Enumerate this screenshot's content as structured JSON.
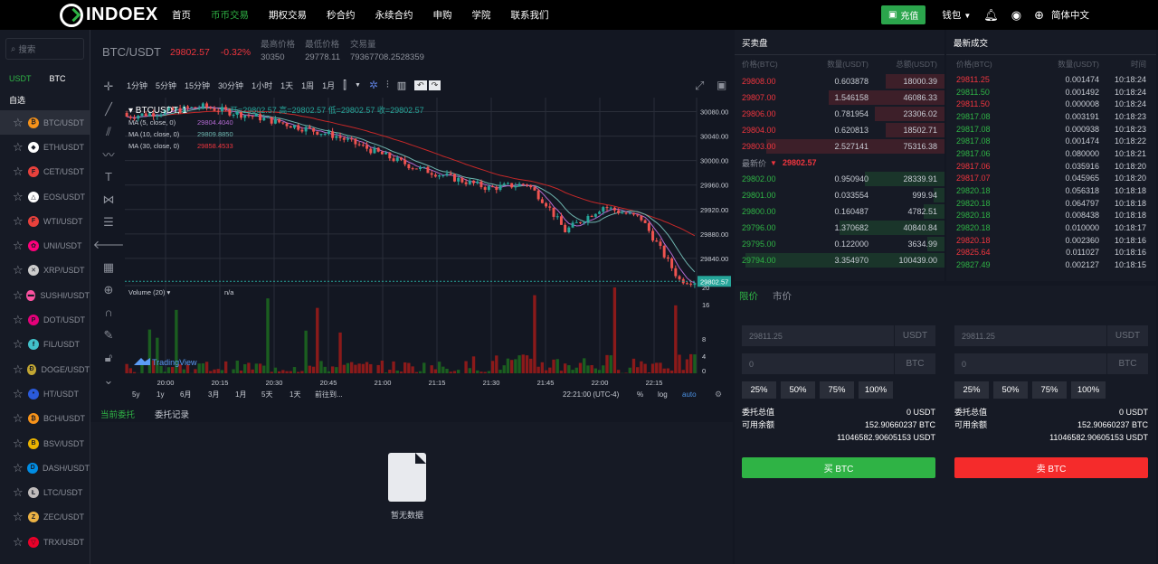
{
  "header": {
    "logo": "INDOEX",
    "nav": [
      "首页",
      "币币交易",
      "期权交易",
      "秒合约",
      "永续合约",
      "申购",
      "学院",
      "联系我们"
    ],
    "recharge": "充值",
    "wallet": "钱包",
    "language": "简体中文"
  },
  "sidebar": {
    "search_placeholder": "搜索",
    "markets": [
      "USDT",
      "BTC"
    ],
    "favorites": "自选",
    "coins": [
      {
        "name": "BTC/USDT",
        "color": "#f7931a",
        "glyph": "₿"
      },
      {
        "name": "ETH/USDT",
        "color": "#ffffff",
        "glyph": "◆"
      },
      {
        "name": "CET/USDT",
        "color": "#e8413c",
        "glyph": "F"
      },
      {
        "name": "EOS/USDT",
        "color": "#ffffff",
        "glyph": "△"
      },
      {
        "name": "WTI/USDT",
        "color": "#e8413c",
        "glyph": "F"
      },
      {
        "name": "UNI/USDT",
        "color": "#ff007a",
        "glyph": "✿"
      },
      {
        "name": "XRP/USDT",
        "color": "#cccccc",
        "glyph": "✕"
      },
      {
        "name": "SUSHI/USDT",
        "color": "#fa52a0",
        "glyph": "▬"
      },
      {
        "name": "DOT/USDT",
        "color": "#e6007a",
        "glyph": "P"
      },
      {
        "name": "FIL/USDT",
        "color": "#42c1ca",
        "glyph": "f"
      },
      {
        "name": "DOGE/USDT",
        "color": "#c2a633",
        "glyph": "Ð"
      },
      {
        "name": "HT/USDT",
        "color": "#2a5ada",
        "glyph": "•"
      },
      {
        "name": "BCH/USDT",
        "color": "#f7931a",
        "glyph": "₿"
      },
      {
        "name": "BSV/USDT",
        "color": "#eab300",
        "glyph": "B"
      },
      {
        "name": "DASH/USDT",
        "color": "#008de4",
        "glyph": "D"
      },
      {
        "name": "LTC/USDT",
        "color": "#bfbbbb",
        "glyph": "Ł"
      },
      {
        "name": "ZEC/USDT",
        "color": "#ecb244",
        "glyph": "Z"
      },
      {
        "name": "TRX/USDT",
        "color": "#eb0029",
        "glyph": "▽"
      }
    ]
  },
  "pair": {
    "name": "BTC/USDT",
    "price": "29802.57",
    "change": "-0.32%",
    "high_label": "最高价格",
    "high": "30350",
    "low_label": "最低价格",
    "low": "29778.11",
    "vol_label": "交易量",
    "vol": "79367708.2528359"
  },
  "chart": {
    "intervals": [
      "1分钟",
      "5分钟",
      "15分钟",
      "30分钟",
      "1小时",
      "1天",
      "1周",
      "1月"
    ],
    "symbol": "BTCUSDT, 1",
    "ohlc": "开=29802.57  高=29802.57  低=29802.57  收=29802.57",
    "ma5": "MA (5, close, 0)",
    "ma5v": "29804.4040",
    "ma10": "MA (10, close, 0)",
    "ma10v": "29809.8850",
    "ma30": "MA (30, close, 0)",
    "ma30v": "29858.4533",
    "volume_label": "Volume (20)",
    "volume_val": "n/a",
    "price_ticks": [
      "30080.00",
      "30040.00",
      "30000.00",
      "29960.00",
      "29920.00",
      "29880.00",
      "29840.00"
    ],
    "last_price_tag": "29802.57",
    "vol_ticks": [
      "20",
      "16",
      "8",
      "4",
      "0"
    ],
    "time_ticks": [
      "20:00",
      "20:15",
      "20:30",
      "20:45",
      "21:00",
      "21:15",
      "21:30",
      "21:45",
      "22:00",
      "22:15"
    ],
    "ranges": [
      "5y",
      "1y",
      "6月",
      "3月",
      "1月",
      "5天",
      "1天",
      "前往到..."
    ],
    "clock": "22:21:00 (UTC-4)",
    "pct": "%",
    "log": "log",
    "auto": "auto",
    "tradingview": "TradingView",
    "up_color": "#26a69a",
    "down_color": "#ef5350"
  },
  "orders": {
    "tabs": [
      "当前委托",
      "委托记录"
    ],
    "empty": "暂无数据"
  },
  "orderbook": {
    "title": "买卖盘",
    "cols": [
      "价格(BTC)",
      "数量(USDT)",
      "总额(USDT)"
    ],
    "asks": [
      {
        "p": "29808.00",
        "a": "0.603878",
        "t": "18000.39",
        "f": 0.28
      },
      {
        "p": "29807.00",
        "a": "1.546158",
        "t": "46086.33",
        "f": 0.55
      },
      {
        "p": "29806.00",
        "a": "0.781954",
        "t": "23306.02",
        "f": 0.33
      },
      {
        "p": "29804.00",
        "a": "0.620813",
        "t": "18502.71",
        "f": 0.28
      },
      {
        "p": "29803.00",
        "a": "2.527141",
        "t": "75316.38",
        "f": 0.85
      }
    ],
    "last_label": "最新价",
    "last": "29802.57",
    "bids": [
      {
        "p": "29802.00",
        "a": "0.950940",
        "t": "28339.91",
        "f": 0.38
      },
      {
        "p": "29801.00",
        "a": "0.033554",
        "t": "999.94",
        "f": 0.05
      },
      {
        "p": "29800.00",
        "a": "0.160487",
        "t": "4782.51",
        "f": 0.1
      },
      {
        "p": "29796.00",
        "a": "1.370682",
        "t": "40840.84",
        "f": 0.5
      },
      {
        "p": "29795.00",
        "a": "0.122000",
        "t": "3634.99",
        "f": 0.08
      },
      {
        "p": "29794.00",
        "a": "3.354970",
        "t": "100439.00",
        "f": 0.95
      }
    ]
  },
  "trades": {
    "title": "最新成交",
    "cols": [
      "价格(BTC)",
      "数量(USDT)",
      "时间"
    ],
    "rows": [
      {
        "p": "29811.25",
        "a": "0.001474",
        "t": "10:18:24",
        "s": "d"
      },
      {
        "p": "29811.50",
        "a": "0.001492",
        "t": "10:18:24",
        "s": "u"
      },
      {
        "p": "29811.50",
        "a": "0.000008",
        "t": "10:18:24",
        "s": "d"
      },
      {
        "p": "29817.08",
        "a": "0.003191",
        "t": "10:18:23",
        "s": "u"
      },
      {
        "p": "29817.08",
        "a": "0.000938",
        "t": "10:18:23",
        "s": "u"
      },
      {
        "p": "29817.08",
        "a": "0.001474",
        "t": "10:18:22",
        "s": "u"
      },
      {
        "p": "29817.06",
        "a": "0.080000",
        "t": "10:18:21",
        "s": "u"
      },
      {
        "p": "29817.06",
        "a": "0.035916",
        "t": "10:18:20",
        "s": "d"
      },
      {
        "p": "29817.07",
        "a": "0.045965",
        "t": "10:18:20",
        "s": "d"
      },
      {
        "p": "29820.18",
        "a": "0.056318",
        "t": "10:18:18",
        "s": "u"
      },
      {
        "p": "29820.18",
        "a": "0.064797",
        "t": "10:18:18",
        "s": "u"
      },
      {
        "p": "29820.18",
        "a": "0.008438",
        "t": "10:18:18",
        "s": "u"
      },
      {
        "p": "29820.18",
        "a": "0.010000",
        "t": "10:18:17",
        "s": "u"
      },
      {
        "p": "29820.18",
        "a": "0.002360",
        "t": "10:18:16",
        "s": "d"
      },
      {
        "p": "29825.64",
        "a": "0.011027",
        "t": "10:18:16",
        "s": "d"
      },
      {
        "p": "29827.49",
        "a": "0.002127",
        "t": "10:18:15",
        "s": "u"
      }
    ]
  },
  "trade": {
    "tabs": [
      "限价",
      "市价"
    ],
    "buy": {
      "price": "29811.25",
      "price_unit": "USDT",
      "amount": "0",
      "amount_unit": "BTC",
      "pcts": [
        "25%",
        "50%",
        "75%",
        "100%"
      ],
      "total_label": "委托总值",
      "total": "0 USDT",
      "avail_label": "可用余额",
      "avail1": "152.90660237 BTC",
      "avail2": "11046582.90605153 USDT",
      "btn": "买 BTC",
      "btn_color": "#2fb345"
    },
    "sell": {
      "price": "29811.25",
      "price_unit": "USDT",
      "amount": "0",
      "amount_unit": "BTC",
      "pcts": [
        "25%",
        "50%",
        "75%",
        "100%"
      ],
      "total_label": "委托总值",
      "total": "0 USDT",
      "avail_label": "可用余额",
      "avail1": "152.90660237 BTC",
      "avail2": "11046582.90605153 USDT",
      "btn": "卖 BTC",
      "btn_color": "#f52b2b"
    }
  },
  "colors": {
    "up": "#2fb345",
    "down": "#f0353e",
    "accent": "#2fb345"
  }
}
